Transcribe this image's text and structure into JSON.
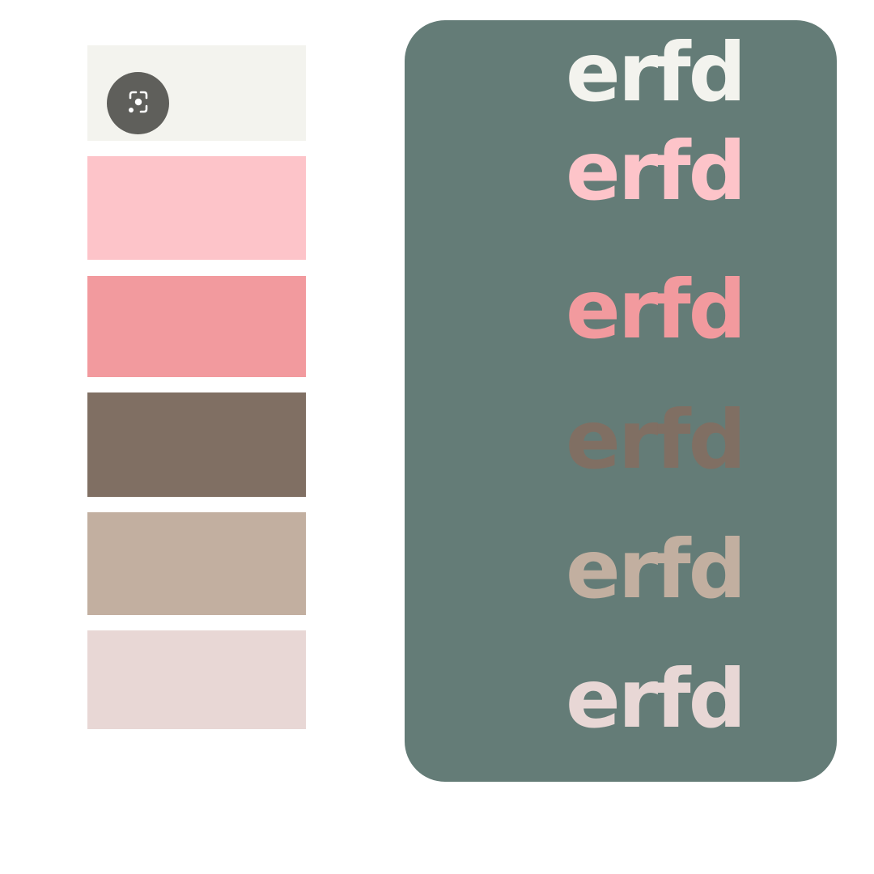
{
  "palette": {
    "swatches": [
      {
        "color": "#f3f3ee"
      },
      {
        "color": "#fdc4c9"
      },
      {
        "color": "#f29a9e"
      },
      {
        "color": "#806f63"
      },
      {
        "color": "#c2afa0"
      },
      {
        "color": "#e8d7d5"
      }
    ]
  },
  "lens_button": {
    "icon": "visual-search-icon"
  },
  "preview": {
    "background": "#647c77",
    "samples": [
      {
        "text": "erfd",
        "color": "#f3f3ee"
      },
      {
        "text": "erfd",
        "color": "#fdc4c9"
      },
      {
        "text": "erfd",
        "color": "#f29a9e"
      },
      {
        "text": "erfd",
        "color": "#806f63"
      },
      {
        "text": "erfd",
        "color": "#c2afa0"
      },
      {
        "text": "erfd",
        "color": "#e8d7d5"
      }
    ]
  }
}
